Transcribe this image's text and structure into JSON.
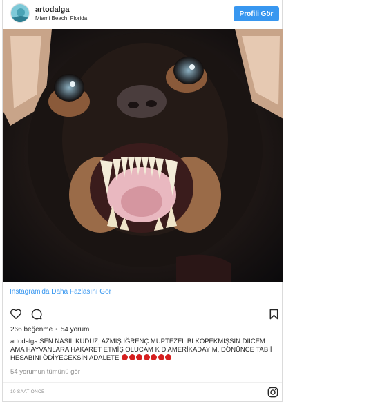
{
  "post": {
    "username": "artodalga",
    "location": "Miami Beach, Florida",
    "profile_button": "Profili Gör",
    "more_link": "Instagram'da Daha Fazlasını Gör",
    "likes": "266 beğenme",
    "separator": "•",
    "comments_count": "54 yorum",
    "caption_user": "artodalga",
    "caption_text": " SEN NASIL KUDUZ, AZMIŞ İĞRENÇ MÜPTEZEL Bİ KÖPEKMİŞSİN DİİCEM AMA HAYVANLARA HAKARET ETMİŞ OLUCAM K D AMERİKADAYIM, DÖNÜNCE TABİİ HESABINI ÖDİYECEKSİN ADALETE",
    "caption_emoji_count": 7,
    "view_all_comments": "54 yorumun tümünü gör",
    "time": "10 SAAT ÖNCE"
  },
  "colors": {
    "accent": "#3897f0",
    "emoji": "#d62020",
    "muted": "#8e8e8e"
  },
  "icons": [
    "heart-icon",
    "comment-icon",
    "bookmark-icon",
    "instagram-logo-icon"
  ]
}
